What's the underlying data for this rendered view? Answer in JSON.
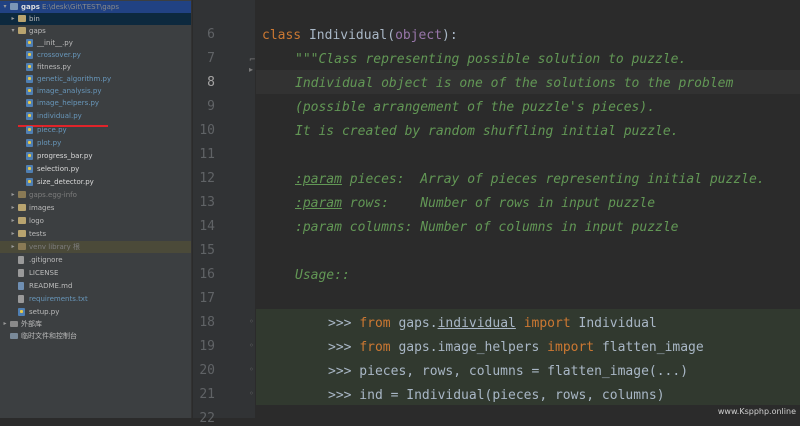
{
  "project": {
    "root_name": "gaps",
    "root_path": "E:\\desk\\Git\\TEST\\gaps",
    "items": [
      {
        "label": "bin"
      },
      {
        "label": "gaps"
      },
      {
        "label": "__init__.py"
      },
      {
        "label": "crossover.py"
      },
      {
        "label": "fitness.py"
      },
      {
        "label": "genetic_algorithm.py"
      },
      {
        "label": "image_analysis.py"
      },
      {
        "label": "image_helpers.py"
      },
      {
        "label": "individual.py"
      },
      {
        "label": "piece.py"
      },
      {
        "label": "plot.py"
      },
      {
        "label": "progress_bar.py"
      },
      {
        "label": "selection.py"
      },
      {
        "label": "size_detector.py"
      },
      {
        "label": "gaps.egg-info"
      },
      {
        "label": "images"
      },
      {
        "label": "logo"
      },
      {
        "label": "tests"
      },
      {
        "label": "venv library 根"
      },
      {
        "label": ".gitignore"
      },
      {
        "label": "LICENSE"
      },
      {
        "label": "README.md"
      },
      {
        "label": "requirements.txt"
      },
      {
        "label": "setup.py"
      },
      {
        "label": "外部库"
      },
      {
        "label": "临时文件和控制台"
      }
    ]
  },
  "editor": {
    "line_numbers": [
      "6",
      "7",
      "8",
      "9",
      "10",
      "11",
      "12",
      "13",
      "14",
      "15",
      "16",
      "17",
      "18",
      "19",
      "20",
      "21",
      "22"
    ],
    "current_line": "8",
    "code": {
      "l6_kw": "class",
      "l6_name": " Individual(",
      "l6_self": "object",
      "l6_end": "):",
      "l7": "\"\"\"Class representing possible solution to puzzle.",
      "l8": "Individual object is one of the solutions to the problem",
      "l9": "(possible arrangement of the puzzle's pieces).",
      "l10": "It is created by random shuffling initial puzzle.",
      "l12_tag": ":param",
      "l12_rest": " pieces:  Array of pieces representing initial puzzle.",
      "l13_tag": ":param",
      "l13_rest": " rows:    Number of rows in input puzzle",
      "l14": ":param columns: Number of columns in input puzzle",
      "l16": "Usage::",
      "l18_prompt": ">>> ",
      "l18_from": "from",
      "l18_mod_a": " gaps.",
      "l18_mod_b": "individual",
      "l18_import": " import",
      "l18_name": " Individual",
      "l19_prompt": ">>> ",
      "l19_from": "from",
      "l19_mod": " gaps.image_helpers",
      "l19_import": " import",
      "l19_name": " flatten_image",
      "l20": ">>> pieces, rows, columns = flatten_image(...)",
      "l21": ">>> ind = Individual(pieces, rows, columns)"
    }
  },
  "watermark": "www.Kspphp.online"
}
